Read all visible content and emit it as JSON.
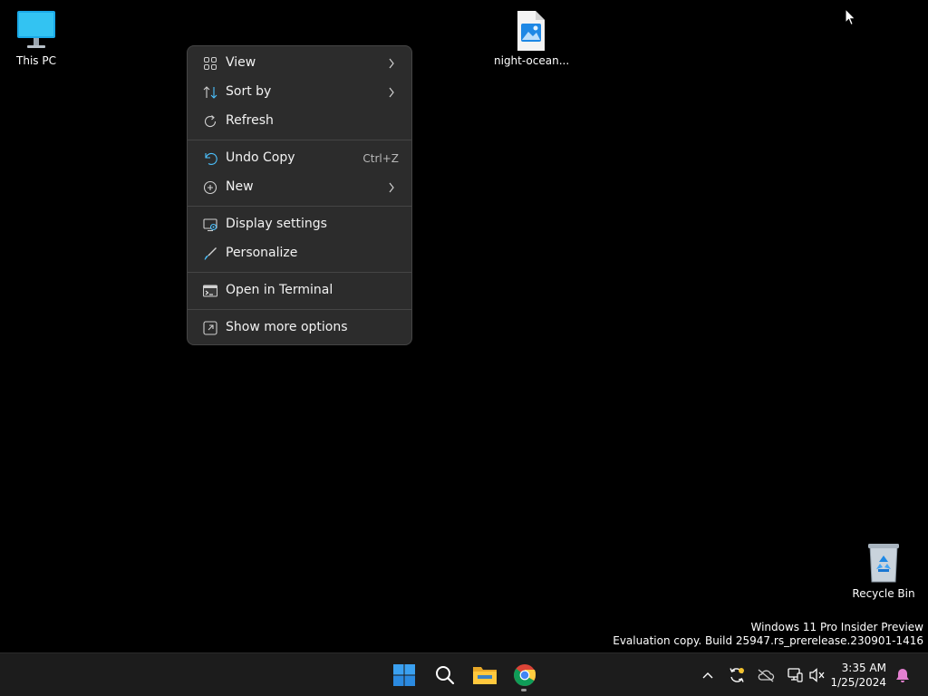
{
  "desktop": {
    "icons": [
      {
        "label": "This PC",
        "icon": "monitor-icon"
      },
      {
        "label": "night-ocean...",
        "icon": "image-file-icon"
      },
      {
        "label": "Recycle Bin",
        "icon": "recycle-bin-icon"
      }
    ],
    "watermark": {
      "line1": "Windows 11 Pro Insider Preview",
      "line2": "Evaluation copy. Build 25947.rs_prerelease.230901-1416"
    }
  },
  "context_menu": {
    "items": [
      {
        "label": "View",
        "icon": "grid-view-icon",
        "submenu": true
      },
      {
        "label": "Sort by",
        "icon": "sort-icon",
        "submenu": true
      },
      {
        "label": "Refresh",
        "icon": "refresh-icon"
      },
      {
        "label": "Undo Copy",
        "icon": "undo-icon",
        "shortcut": "Ctrl+Z"
      },
      {
        "label": "New",
        "icon": "plus-circle-icon",
        "submenu": true
      },
      {
        "label": "Display settings",
        "icon": "display-settings-icon"
      },
      {
        "label": "Personalize",
        "icon": "brush-icon"
      },
      {
        "label": "Open in Terminal",
        "icon": "terminal-icon"
      },
      {
        "label": "Show more options",
        "icon": "more-options-icon"
      }
    ]
  },
  "taskbar": {
    "apps": [
      "start-icon",
      "search-icon",
      "file-explorer-icon",
      "chrome-icon"
    ],
    "tray": [
      "chevron-up-icon",
      "sync-icon",
      "cloud-off-icon",
      "network-icon",
      "volume-muted-icon"
    ],
    "time": "3:35 AM",
    "date": "1/25/2024",
    "notification_icon": "bell-icon"
  },
  "colors": {
    "menu_bg": "#2c2c2c",
    "accent_blue": "#4cc2ff",
    "taskbar_bg": "#1c1c1c"
  }
}
